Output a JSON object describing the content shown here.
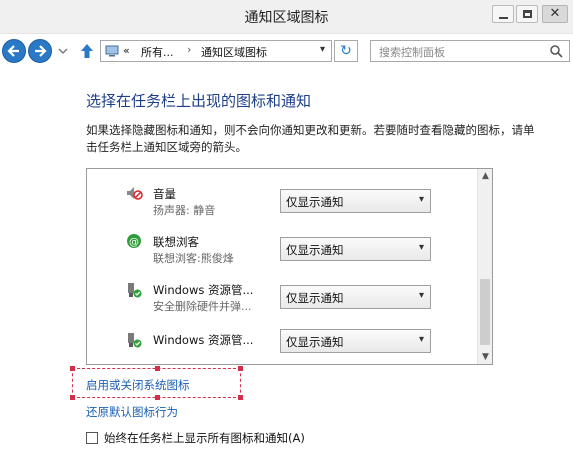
{
  "window": {
    "title": "通知区域图标"
  },
  "nav": {
    "address_prefix": "«",
    "address_part1": "所有...",
    "address_sep": "›",
    "address_part2": "通知区域图标",
    "search_placeholder": "搜索控制面板"
  },
  "main": {
    "heading": "选择在任务栏上出现的图标和通知",
    "description": "如果选择隐藏图标和通知，则不会向你通知更改和更新。若要随时查看隐藏的图标，请单击任务栏上通知区域旁的箭头。",
    "rows": [
      {
        "name": "音量",
        "sub": "扬声器: 静音",
        "icon": "speaker-muted-icon",
        "setting": "仅显示通知"
      },
      {
        "name": "联想浏客",
        "sub": "联想浏客:熊俊烽",
        "icon": "lenovo-at-icon",
        "setting": "仅显示通知"
      },
      {
        "name": "Windows 资源管...",
        "sub": "安全删除硬件并弹...",
        "icon": "usb-device-icon",
        "setting": "仅显示通知"
      },
      {
        "name": "Windows 资源管...",
        "sub": "",
        "icon": "usb-device-icon",
        "setting": "仅显示通知"
      }
    ],
    "link_system_icons": "启用或关闭系统图标",
    "link_restore": "还原默认图标行为",
    "checkbox_label": "始终在任务栏上显示所有图标和通知(A)",
    "checkbox_checked": false
  },
  "colors": {
    "accent": "#2a79c6",
    "heading": "#1e3f8a",
    "link": "#1a5fb4",
    "highlight_border": "#d0304a"
  }
}
